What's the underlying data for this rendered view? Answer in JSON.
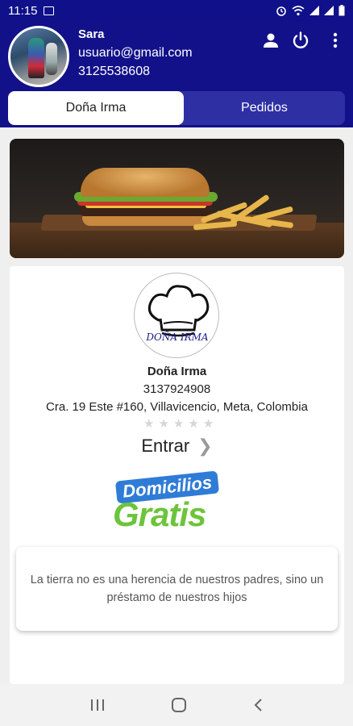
{
  "status_bar": {
    "time": "11:15",
    "icons": [
      "image-icon",
      "alarm-icon",
      "wifi-icon",
      "signal-icon",
      "signal-icon",
      "battery-icon"
    ]
  },
  "header": {
    "user_name": "Sara",
    "user_email": "usuario@gmail.com",
    "user_phone": "3125538608",
    "icons": [
      "person-icon",
      "power-icon",
      "more-vert-icon"
    ],
    "tabs": [
      {
        "label": "Doña Irma",
        "active": true
      },
      {
        "label": "Pedidos",
        "active": false
      }
    ]
  },
  "store": {
    "logo_text": "DOÑA IRMA",
    "name": "Doña Irma",
    "phone": "3137924908",
    "address": "Cra. 19 Este #160, Villavicencio, Meta, Colombia",
    "rating": 0,
    "rating_max": 5,
    "enter_label": "Entrar",
    "promo_line1": "Domicilios",
    "promo_line2": "Gratis",
    "quote": "La tierra no es una herencia de nuestros padres, sino un préstamo de nuestros hijos"
  },
  "nav_bar": {
    "icons": [
      "recent-apps-icon",
      "home-icon",
      "back-icon"
    ]
  },
  "colors": {
    "primary": "#12118a",
    "tab_inactive": "#2f2fa4",
    "promo_blue": "#2f7cd6",
    "promo_green": "#6cc43a"
  }
}
